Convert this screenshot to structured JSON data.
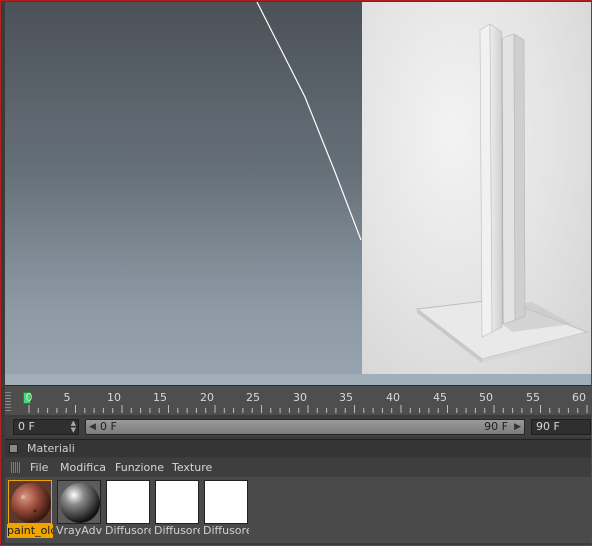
{
  "timeline": {
    "ticks": [
      "0",
      "5",
      "10",
      "15",
      "20",
      "25",
      "30",
      "35",
      "40",
      "45",
      "50",
      "55",
      "60"
    ]
  },
  "range": {
    "start_field": "0 F",
    "slider_start": "0 F",
    "slider_end": "90 F",
    "end_field": "90 F"
  },
  "materials": {
    "panel_title": "Materiali",
    "menu": [
      "File",
      "Modifica",
      "Funzione",
      "Texture"
    ],
    "items": [
      {
        "name": "paint_olc",
        "selected": true
      },
      {
        "name": "VrayAdva",
        "selected": false
      },
      {
        "name": "Diffusore",
        "selected": false
      },
      {
        "name": "Diffusore",
        "selected": false
      },
      {
        "name": "Diffusore",
        "selected": false
      }
    ]
  },
  "colors": {
    "selection_accent": "#f0a400",
    "playhead": "#3ddc6c",
    "frame_border": "#b32020"
  },
  "icons": {
    "menu_grip": "grip-icon",
    "panel_toggle": "square-icon",
    "scroll_left": "arrow-left-icon",
    "scroll_right": "arrow-right-icon"
  }
}
